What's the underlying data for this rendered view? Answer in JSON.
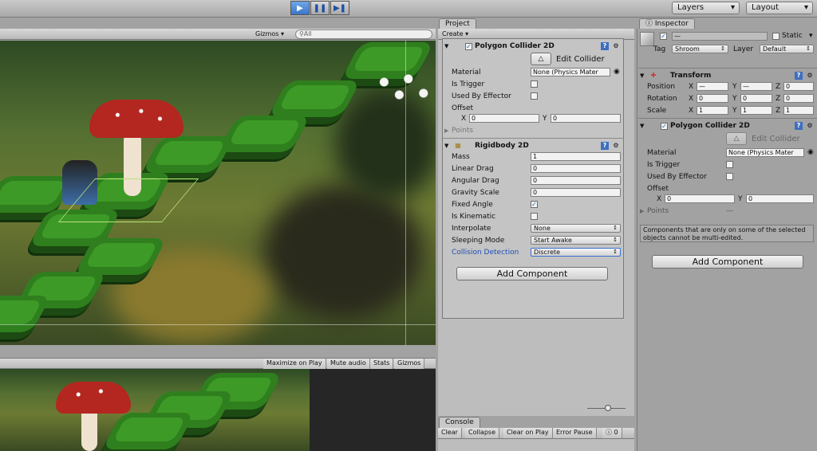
{
  "toolbar": {
    "play_icon": "play-icon",
    "pause_icon": "pause-icon",
    "step_icon": "step-icon",
    "layers": "Layers",
    "layout": "Layout"
  },
  "scene": {
    "gizmos": "Gizmos",
    "search_placeholder": "All"
  },
  "game_bar": {
    "maximize": "Maximize on Play",
    "mute": "Mute audio",
    "stats": "Stats",
    "gizmos": "Gizmos"
  },
  "project": {
    "tab": "Project",
    "create": "Create"
  },
  "project_inspector": {
    "polygon_collider": {
      "title": "Polygon Collider 2D",
      "edit_collider": "Edit Collider",
      "material_label": "Material",
      "material_value": "None (Physics Mater",
      "is_trigger": "Is Trigger",
      "used_by_effector": "Used By Effector",
      "offset": "Offset",
      "x_label": "X",
      "x_value": "0",
      "y_label": "Y",
      "y_value": "0",
      "points": "Points"
    },
    "rigidbody": {
      "title": "Rigidbody 2D",
      "mass_label": "Mass",
      "mass": "1",
      "linear_drag_label": "Linear Drag",
      "linear_drag": "0",
      "angular_drag_label": "Angular Drag",
      "angular_drag": "0",
      "gravity_scale_label": "Gravity Scale",
      "gravity_scale": "0",
      "fixed_angle_label": "Fixed Angle",
      "is_kinematic_label": "Is Kinematic",
      "interpolate_label": "Interpolate",
      "interpolate": "None",
      "sleeping_mode_label": "Sleeping Mode",
      "sleeping_mode": "Start Awake",
      "collision_detection_label": "Collision Detection",
      "collision_detection": "Discrete"
    },
    "add_component": "Add Component"
  },
  "console": {
    "tab": "Console",
    "clear": "Clear",
    "collapse": "Collapse",
    "clear_on_play": "Clear on Play",
    "error_pause": "Error Pause",
    "count": "0"
  },
  "inspector": {
    "tab": "Inspector",
    "name_value": "—",
    "static": "Static",
    "tag_label": "Tag",
    "tag_value": "Shroom",
    "layer_label": "Layer",
    "layer_value": "Default",
    "transform": {
      "title": "Transform",
      "position": "Position",
      "rotation": "Rotation",
      "scale": "Scale",
      "x": "X",
      "y": "Y",
      "z": "Z",
      "pos": [
        "—",
        "—",
        "0"
      ],
      "rot": [
        "0",
        "0",
        "0"
      ],
      "scl": [
        "1",
        "1",
        "1"
      ]
    },
    "polygon_collider": {
      "title": "Polygon Collider 2D",
      "edit_collider": "Edit Collider",
      "material_label": "Material",
      "material_value": "None (Physics Mater",
      "is_trigger": "Is Trigger",
      "used_by_effector": "Used By Effector",
      "offset": "Offset",
      "x_value": "0",
      "y_value": "0",
      "points": "Points",
      "points_value": "—"
    },
    "multi_edit_note": "Components that are only on some of the selected objects cannot be multi-edited.",
    "add_component": "Add Component"
  }
}
